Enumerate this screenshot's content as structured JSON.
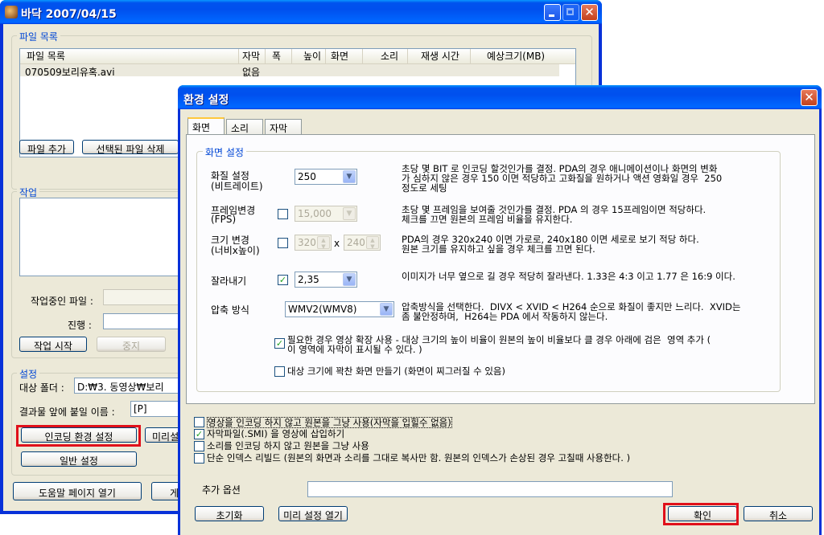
{
  "main_window": {
    "title": "바닥 2007/04/15",
    "file_group": {
      "label": "파일 목록",
      "columns": [
        "파일 목록",
        "자막",
        "폭",
        "높이",
        "화면",
        "소리",
        "재생 시간",
        "예상크기(MB)"
      ],
      "rows": [
        {
          "name": "070509보리유혹.avi",
          "subtitle": "없음"
        }
      ],
      "add_button": "파일 추가",
      "delete_button": "선택된 파일 삭제"
    },
    "work_group": {
      "label": "작업",
      "current_file_label": "작업중인 파일 :",
      "progress_label": "진행 :",
      "start_button": "작업 시작",
      "stop_button": "중지"
    },
    "settings_group": {
      "label": "설정",
      "target_folder_label": "대상 폴더 :",
      "target_folder_value": "D:₩3. 동영상₩보리",
      "prefix_label": "결과물 앞에 붙일 이름 :",
      "prefix_value": "[P]",
      "encoding_settings_button": "인코딩 환경 설정",
      "preset_button_partial": "미리설",
      "general_settings_button": "일반 설정"
    },
    "help_button": "도움말 페이지 열기",
    "partial_button": "게"
  },
  "dialog": {
    "title": "환경 설정",
    "tabs": [
      "화면",
      "소리",
      "자막"
    ],
    "screen_group": {
      "label": "화면 설정",
      "quality": {
        "label1": "화질 설정",
        "label2": "(비트레이트)",
        "value": "250",
        "desc": "초당 몇 BIT 로 인코딩 할것인가를 결정. PDA의 경우 애니메이션이나 화면의 변화\n가 심하지 않은 경우 150 이면 적당하고 고화질을 원하거나 액션 영화일 경우  250\n정도로 세팅"
      },
      "fps": {
        "label1": "프레임변경",
        "label2": "(FPS)",
        "checked": false,
        "value": "15,000",
        "desc": "초당 몇 프레임을 보여줄 것인가를 결정. PDA 의 경우 15프레임이면 적당하다.\n체크를 끄면 원본의 프레임 비율을 유지한다."
      },
      "size": {
        "label1": "크기 변경",
        "label2": "(너비x높이)",
        "checked": false,
        "width": "320",
        "x": "x",
        "height": "240",
        "desc": "PDA의 경우 320x240 이면 가로로, 240x180 이면 세로로 보기 적당 하다.\n원본 크기를 유지하고 싶을 경우 체크를 끄면 된다."
      },
      "crop": {
        "label": "잘라내기",
        "checked": true,
        "value": "2,35",
        "desc": "이미지가 너무 옆으로 길 경우 적당히 잘라낸다. 1.33은 4:3 이고 1.77 은 16:9 이다."
      },
      "codec": {
        "label": "압축 방식",
        "value": "WMV2(WMV8)",
        "desc": "압축방식을 선택한다.  DIVX < XVID < H264 순으로 화질이 좋지만 느리다.  XVID는\n좀 불안정하며,  H264는 PDA 에서 작동하지 않는다."
      },
      "expand_option": {
        "checked": true,
        "text": "필요한 경우 영상 확장 사용 - 대상 크기의 높이 비율이 원본의 높이 비율보다 클 경우 아래에 검은  영역 추가 (\n이 영역에 자막이 표시될 수 있다. )"
      },
      "fill_option": {
        "checked": false,
        "text": "대상 크기에 꽉찬 화면 만들기 (화면이 찌그러질 수 있음)"
      }
    },
    "options": [
      {
        "checked": false,
        "text": "영상을 인코딩 하지 않고 원본을 그냥 사용(자막을 입힐수 없음)"
      },
      {
        "checked": true,
        "text": "자막파일(.SMI) 을 영상에 삽입하기"
      },
      {
        "checked": false,
        "text": "소리를 인코딩 하지 않고 원본을 그냥 사용"
      },
      {
        "checked": false,
        "text": "단순 인덱스 리빌드 (원본의 화면과 소리를 그대로 복사만 함. 원본의 인덱스가 손상된 경우 고칠때 사용한다. )"
      }
    ],
    "extra_label": "추가 옵션",
    "extra_value": "",
    "reset_button": "초기화",
    "preset_button": "미리 설정 열기",
    "ok_button": "확인",
    "cancel_button": "취소"
  },
  "colors": {
    "highlight_red": "#e0101a",
    "group_label_blue": "#0046d5"
  }
}
